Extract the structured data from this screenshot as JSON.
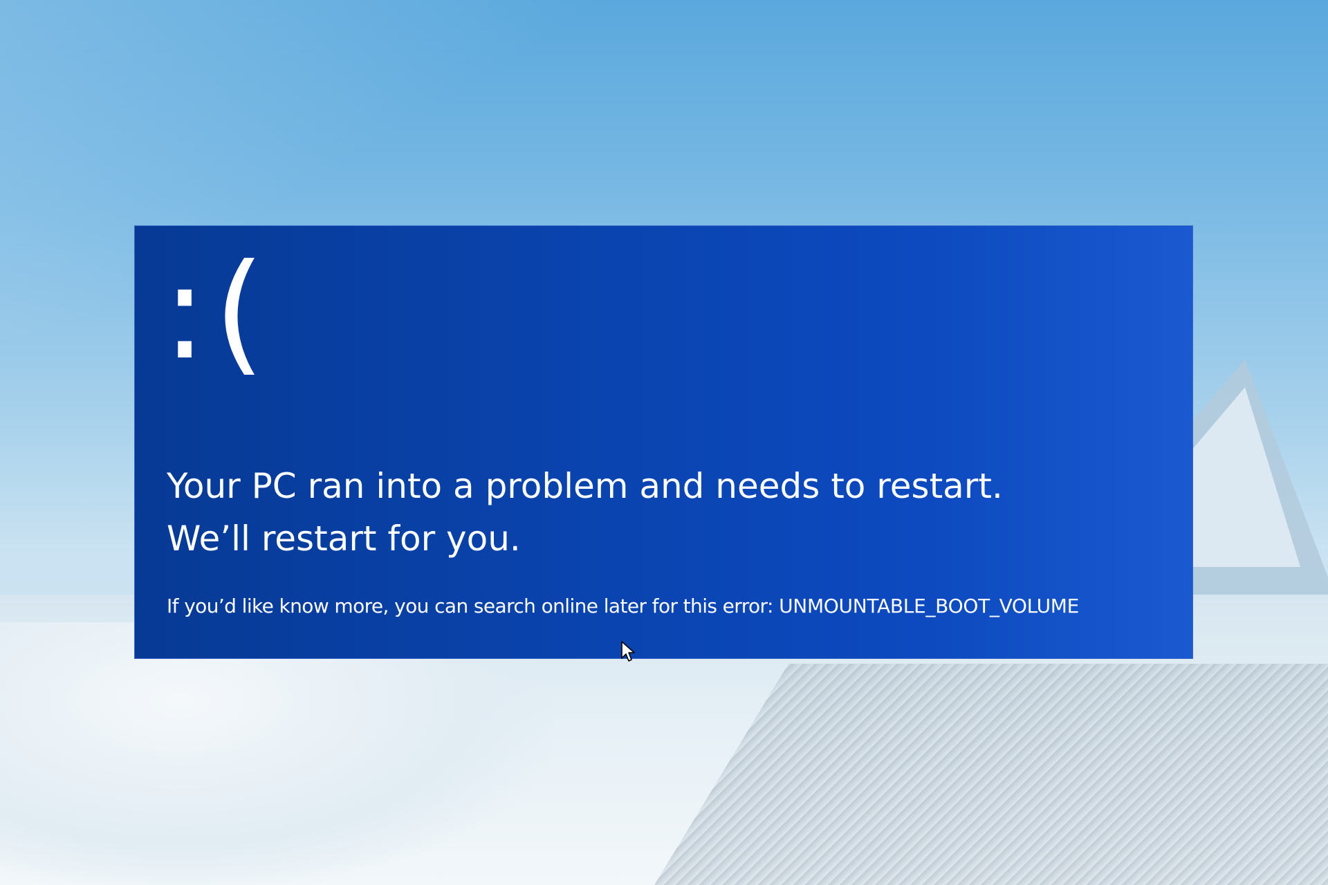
{
  "bsod": {
    "emoticon": ":(",
    "headline_line1": "Your PC ran into a problem and needs to restart.",
    "headline_line2": "We’ll restart for you.",
    "info_prefix": "If you’d like know more, you can search online later for this error: ",
    "error_code": "UNMOUNTABLE_BOOT_VOLUME",
    "background_color": "#0a43ad",
    "text_color": "#ffffff"
  },
  "icons": {
    "pointer": "mouse-pointer-icon"
  }
}
